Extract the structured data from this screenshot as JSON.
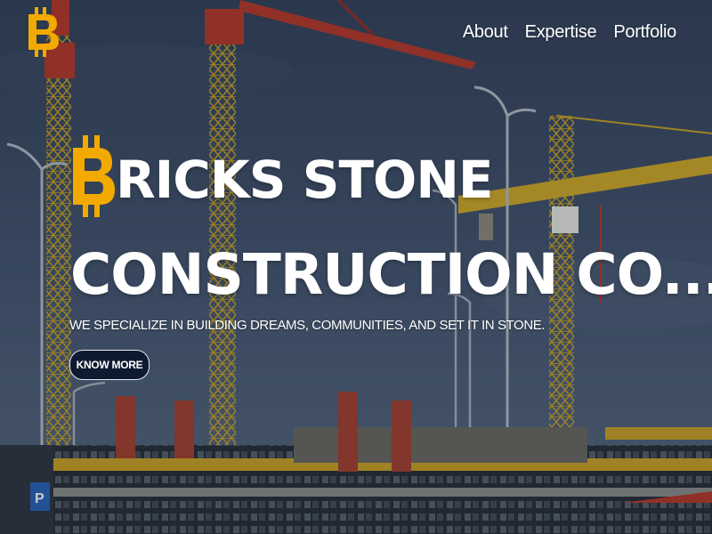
{
  "brand": {
    "logo_icon": "bitcoin-b-icon",
    "accent_color": "#f2a900"
  },
  "nav": {
    "items": [
      {
        "label": "About"
      },
      {
        "label": "Expertise"
      },
      {
        "label": "Portfolio"
      }
    ]
  },
  "hero": {
    "title_line1": "RICKS STONE",
    "title_line2": "CONSTRUCTION CO...",
    "tagline": "WE SPECIALIZE IN BUILDING DREAMS, COMMUNITIES, AND SET IT IN STONE.",
    "cta_label": "KNOW MORE",
    "cta_bg": "#0e1a30"
  },
  "background": {
    "parking_sign": "P"
  }
}
